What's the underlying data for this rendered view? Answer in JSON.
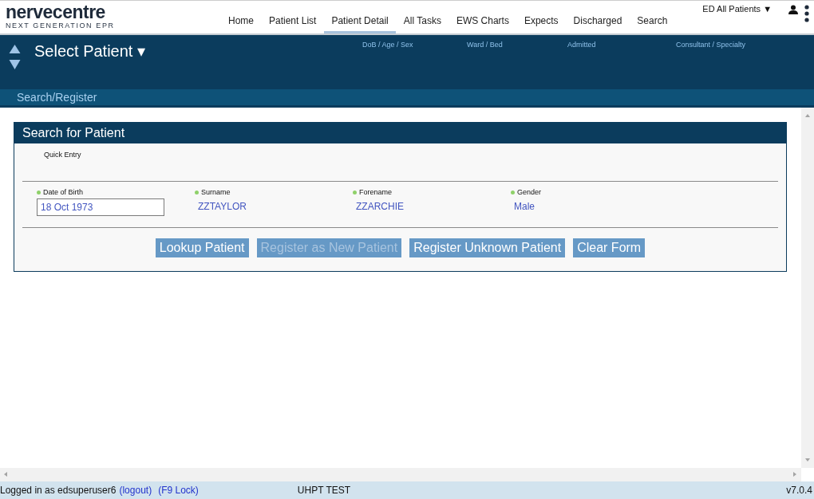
{
  "logo": {
    "name": "nervecentre",
    "tagline": "NEXT GENERATION EPR"
  },
  "nav": [
    {
      "label": "Home",
      "selected": false
    },
    {
      "label": "Patient List",
      "selected": false
    },
    {
      "label": "Patient Detail",
      "selected": true
    },
    {
      "label": "All Tasks",
      "selected": false
    },
    {
      "label": "EWS Charts",
      "selected": false
    },
    {
      "label": "Expects",
      "selected": false
    },
    {
      "label": "Discharged",
      "selected": false
    },
    {
      "label": "Search",
      "selected": false
    }
  ],
  "ward_selector": {
    "label": "ED All Patients",
    "caret": "▼"
  },
  "patient_header": {
    "title": "Select Patient",
    "caret": "▾",
    "columns": [
      "DoB / Age / Sex",
      "Ward / Bed",
      "Admitted",
      "Consultant / Specialty"
    ]
  },
  "breadcrumb": "Search/Register",
  "search_panel": {
    "title": "Search for Patient",
    "quick_entry_label": "Quick Entry",
    "fields": [
      {
        "kind": "input",
        "label": "Date of Birth",
        "value": "18 Oct 1973",
        "required": true
      },
      {
        "kind": "text",
        "label": "Surname",
        "value": "ZZTAYLOR",
        "required": true
      },
      {
        "kind": "text",
        "label": "Forename",
        "value": "ZZARCHIE",
        "required": true
      },
      {
        "kind": "text",
        "label": "Gender",
        "value": "Male",
        "required": true
      }
    ],
    "buttons": [
      {
        "label": "Lookup Patient",
        "disabled": false
      },
      {
        "label": "Register as New Patient",
        "disabled": true
      },
      {
        "label": "Register Unknown Patient",
        "disabled": false
      },
      {
        "label": "Clear Form",
        "disabled": false
      }
    ]
  },
  "status_bar": {
    "user_text": "Logged in as edsuperuser6",
    "logout": "(logout)",
    "lock": "(F9 Lock)",
    "environment": "UHPT TEST",
    "version": "v7.0.4"
  }
}
